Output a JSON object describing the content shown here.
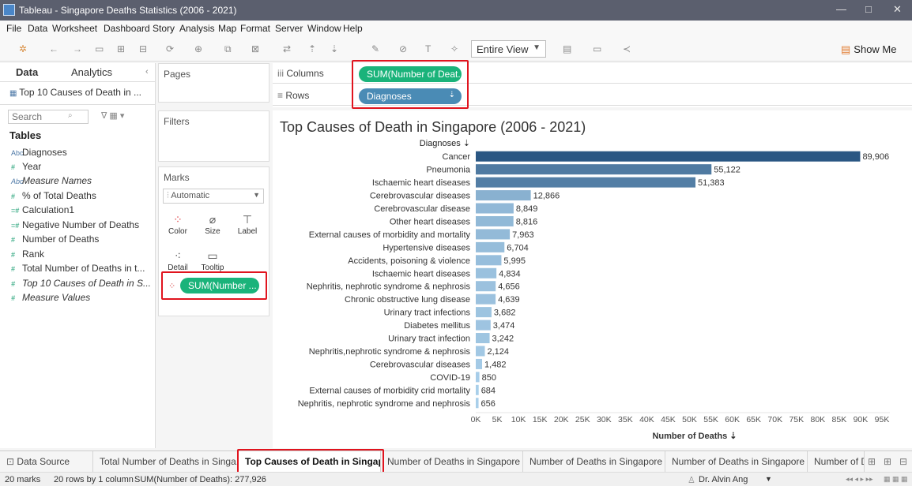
{
  "window": {
    "title": "Tableau - Singapore Deaths Statistics (2006 - 2021)",
    "min": "—",
    "max": "□",
    "close": "✕"
  },
  "menu": [
    "File",
    "Data",
    "Worksheet",
    "Dashboard",
    "Story",
    "Analysis",
    "Map",
    "Format",
    "Server",
    "Window",
    "Help"
  ],
  "toolbar": {
    "view_mode": "Entire View",
    "show_me": "Show Me"
  },
  "datapane": {
    "tab_data": "Data",
    "tab_analytics": "Analytics",
    "source": "Top 10 Causes of Death in ...",
    "search_placeholder": "Search",
    "tables_heading": "Tables",
    "fields": [
      {
        "name": "Diagnoses",
        "icon": "Abc",
        "kind": "dim",
        "italic": false
      },
      {
        "name": "Year",
        "icon": "#",
        "kind": "meas",
        "italic": false
      },
      {
        "name": "Measure Names",
        "icon": "Abc",
        "kind": "dim",
        "italic": true
      },
      {
        "name": "% of Total Deaths",
        "icon": "#",
        "kind": "meas",
        "italic": false
      },
      {
        "name": "Calculation1",
        "icon": "=#",
        "kind": "meas",
        "italic": false
      },
      {
        "name": "Negative Number of Deaths",
        "icon": "=#",
        "kind": "meas",
        "italic": false
      },
      {
        "name": "Number of Deaths",
        "icon": "#",
        "kind": "meas",
        "italic": false
      },
      {
        "name": "Rank",
        "icon": "#",
        "kind": "meas",
        "italic": false
      },
      {
        "name": "Total Number of Deaths in t...",
        "icon": "#",
        "kind": "meas",
        "italic": false
      },
      {
        "name": "Top 10 Causes of Death in S...",
        "icon": "#",
        "kind": "meas",
        "italic": true
      },
      {
        "name": "Measure Values",
        "icon": "#",
        "kind": "meas",
        "italic": true
      }
    ]
  },
  "cards": {
    "pages": "Pages",
    "filters": "Filters",
    "marks": "Marks",
    "mark_type": "Automatic",
    "buttons": [
      {
        "label": "Color",
        "icon": "color-icon"
      },
      {
        "label": "Size",
        "icon": "size-icon"
      },
      {
        "label": "Label",
        "icon": "label-icon"
      },
      {
        "label": "Detail",
        "icon": "detail-icon"
      },
      {
        "label": "Tooltip",
        "icon": "tooltip-icon"
      }
    ],
    "color_pill": "SUM(Number ..."
  },
  "shelves": {
    "columns_label": "Columns",
    "columns_pill": "SUM(Number of Deat..",
    "rows_label": "Rows",
    "rows_pill": "Diagnoses"
  },
  "chart_data": {
    "type": "bar",
    "orientation": "horizontal",
    "title": "Top Causes of Death in Singapore (2006 - 2021)",
    "row_header": "Diagnoses",
    "xlabel": "Number of Deaths",
    "xlim": [
      0,
      95000
    ],
    "xticks": [
      "0K",
      "5K",
      "10K",
      "15K",
      "20K",
      "25K",
      "30K",
      "35K",
      "40K",
      "45K",
      "50K",
      "55K",
      "60K",
      "65K",
      "70K",
      "75K",
      "80K",
      "85K",
      "90K",
      "95K"
    ],
    "categories": [
      "Cancer",
      "Pneumonia",
      "Ischaemic heart diseases",
      "Cerebrovascular diseases",
      "Cerebrovascular disease",
      "Other heart diseases",
      "External causes of morbidity and mortality",
      "Hypertensive diseases",
      "Accidents, poisoning & violence",
      "Ischaemic heart diseases",
      "Nephritis, nephrotic syndrome & nephrosis",
      "Chronic obstructive lung disease",
      "Urinary tract infections",
      "Diabetes mellitus",
      "Urinary tract infection",
      "Nephritis,nephrotic syndrome & nephrosis",
      "Cerebrovascular  diseases",
      "COVID-19",
      "External causes  of morbidity crid mortality",
      "Nephritis, nephrotic syndrome and nephrosis"
    ],
    "values": [
      89906,
      55122,
      51383,
      12866,
      8849,
      8816,
      7963,
      6704,
      5995,
      4834,
      4656,
      4639,
      3682,
      3474,
      3242,
      2124,
      1482,
      850,
      684,
      656
    ],
    "value_labels": [
      "89,906",
      "55,122",
      "51,383",
      "12,866",
      "8,849",
      "8,816",
      "7,963",
      "6,704",
      "5,995",
      "4,834",
      "4,656",
      "4,639",
      "3,682",
      "3,474",
      "3,242",
      "2,124",
      "1,482",
      "850",
      "684",
      "656"
    ],
    "color_low": "#a9cfea",
    "color_high": "#2a5783",
    "grid": false
  },
  "sheets": [
    {
      "label": "Data Source",
      "icon": "⊡"
    },
    {
      "label": "Total Number of Deaths in Singa..."
    },
    {
      "label": "Top Causes of Death in Singap..."
    },
    {
      "label": "Number of Deaths in Singapore ..."
    },
    {
      "label": "Number of Deaths in Singapore ..."
    },
    {
      "label": "Number of Deaths in Singapore ..."
    },
    {
      "label": "Number of De..."
    }
  ],
  "status": {
    "marks": "20 marks",
    "rows": "20 rows by 1 column",
    "sum": "SUM(Number of Deaths): 277,926",
    "user": "Dr. Alvin Ang"
  }
}
